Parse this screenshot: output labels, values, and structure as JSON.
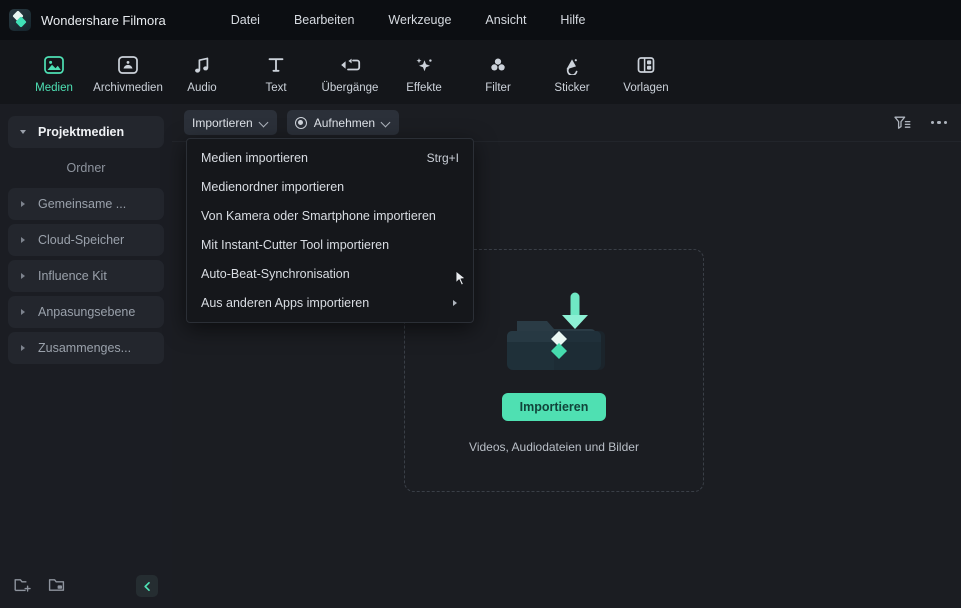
{
  "window": {
    "app_name": "Wondershare Filmora",
    "logo_icon": "filmora-logo-icon"
  },
  "menubar": {
    "items": [
      {
        "label": "Datei",
        "name": "menu-datei"
      },
      {
        "label": "Bearbeiten",
        "name": "menu-bearbeiten"
      },
      {
        "label": "Werkzeuge",
        "name": "menu-werkzeuge"
      },
      {
        "label": "Ansicht",
        "name": "menu-ansicht"
      },
      {
        "label": "Hilfe",
        "name": "menu-hilfe"
      }
    ]
  },
  "toolbar": {
    "items": [
      {
        "label": "Medien",
        "icon": "media-icon",
        "active": true
      },
      {
        "label": "Archivmedien",
        "icon": "stock-media-icon",
        "active": false
      },
      {
        "label": "Audio",
        "icon": "audio-note-icon",
        "active": false
      },
      {
        "label": "Text",
        "icon": "text-icon",
        "active": false
      },
      {
        "label": "Übergänge",
        "icon": "transitions-icon",
        "active": false
      },
      {
        "label": "Effekte",
        "icon": "effects-sparkle-icon",
        "active": false
      },
      {
        "label": "Filter",
        "icon": "filter-circles-icon",
        "active": false
      },
      {
        "label": "Sticker",
        "icon": "sticker-icon",
        "active": false
      },
      {
        "label": "Vorlagen",
        "icon": "templates-icon",
        "active": false
      }
    ],
    "active_color": "#4ee0b4"
  },
  "sidebar": {
    "items": [
      {
        "label": "Projektmedien",
        "expanded": true,
        "selected": true,
        "has_caret": true
      },
      {
        "label": "Ordner",
        "expanded": false,
        "selected": false,
        "has_caret": false
      },
      {
        "label": "Gemeinsame ...",
        "expanded": false,
        "selected": false,
        "has_caret": true
      },
      {
        "label": "Cloud-Speicher",
        "expanded": false,
        "selected": false,
        "has_caret": true
      },
      {
        "label": "Influence Kit",
        "expanded": false,
        "selected": false,
        "has_caret": true
      },
      {
        "label": "Anpasungsebene",
        "expanded": false,
        "selected": false,
        "has_caret": true
      },
      {
        "label": "Zusammenges...",
        "expanded": false,
        "selected": false,
        "has_caret": true
      }
    ],
    "bottom": {
      "new_folder_icon": "new-folder-icon",
      "smart_folder_icon": "smart-folder-icon",
      "collapse_icon": "collapse-panel-icon"
    }
  },
  "main_toolbar": {
    "import_label": "Importieren",
    "record_label": "Aufnehmen",
    "record_icon": "record-dot-icon",
    "filter_icon": "filter-sort-icon",
    "more_icon": "more-options-icon"
  },
  "dropdown": {
    "open": true,
    "items": [
      {
        "label": "Medien importieren",
        "shortcut": "Strg+I",
        "submenu": false
      },
      {
        "label": "Medienordner importieren",
        "shortcut": "",
        "submenu": false
      },
      {
        "label": "Von Kamera oder Smartphone importieren",
        "shortcut": "",
        "submenu": false
      },
      {
        "label": "Mit Instant-Cutter Tool importieren",
        "shortcut": "",
        "submenu": false
      },
      {
        "label": "Auto-Beat-Synchronisation",
        "shortcut": "",
        "submenu": false
      },
      {
        "label": "Aus anderen Apps importieren",
        "shortcut": "",
        "submenu": true
      }
    ]
  },
  "dropzone": {
    "folder_icon": "import-folder-icon",
    "button_label": "Importieren",
    "hint": "Videos, Audiodateien und Bilder",
    "accent_color": "#4fe0b2"
  }
}
